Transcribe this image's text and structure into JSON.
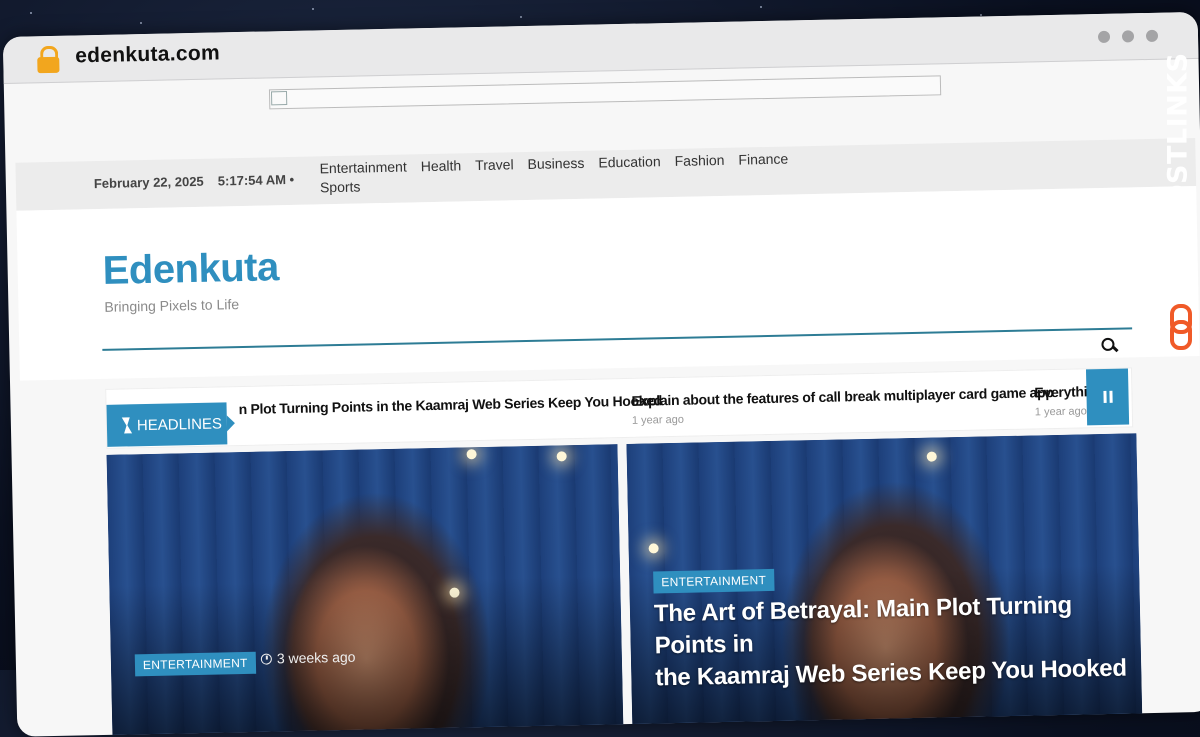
{
  "browser": {
    "url": "edenkuta.com"
  },
  "topbar": {
    "date": "February 22, 2025",
    "time": "5:17:54 AM",
    "menu": [
      "Entertainment",
      "Health",
      "Travel",
      "Business",
      "Education",
      "Fashion",
      "Finance",
      "Sports"
    ]
  },
  "site": {
    "title": "Edenkuta",
    "tagline": "Bringing Pixels to Life"
  },
  "ticker": {
    "label": "HEADLINES",
    "items": [
      {
        "title": "n Plot Turning Points in the Kaamraj Web Series Keep You Hooked",
        "time": ""
      },
      {
        "title": "Explain about the features of call break multiplayer card game app",
        "time": "1 year ago"
      },
      {
        "title": "Everythir",
        "time": "1 year ago"
      }
    ]
  },
  "cards": [
    {
      "category": "ENTERTAINMENT",
      "time": "3 weeks ago"
    },
    {
      "category": "ENTERTAINMENT",
      "title_line1": "The Art of Betrayal: Main Plot Turning Points in",
      "title_line2": "the Kaamraj Web Series Keep You Hooked"
    }
  ],
  "watermark": {
    "text": "GUESTPOSTLINKS"
  },
  "colors": {
    "accent": "#2f8fbf",
    "brand_orange": "#f05a28"
  },
  "icons": [
    "lock-icon",
    "search-icon",
    "bolt-icon",
    "pause-icon",
    "clock-icon",
    "link-icon"
  ]
}
